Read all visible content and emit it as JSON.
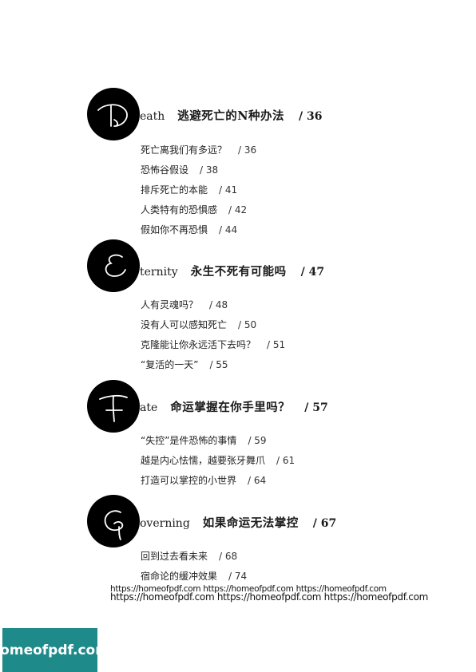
{
  "sections": [
    {
      "initial": "D",
      "english_rest": "eath",
      "chinese_title": "逃避死亡的N种办法",
      "page": "/ 36",
      "items": [
        {
          "title": "死亡离我们有多远？",
          "page": "/ 36"
        },
        {
          "title": "恐怖谷假设",
          "page": "/ 38"
        },
        {
          "title": "排斥死亡的本能",
          "page": "/ 41"
        },
        {
          "title": "人类特有的恐惧感",
          "page": "/ 42"
        },
        {
          "title": "假如你不再恐惧",
          "page": "/ 44"
        }
      ]
    },
    {
      "initial": "E",
      "english_rest": "ternity",
      "chinese_title": "永生不死有可能吗",
      "page": "/ 47",
      "items": [
        {
          "title": "人有灵魂吗？",
          "page": "/ 48"
        },
        {
          "title": "没有人可以感知死亡",
          "page": "/ 50"
        },
        {
          "title": "克隆能让你永远活下去吗？",
          "page": "/ 51"
        },
        {
          "title": "“复活的一天”",
          "page": "/ 55"
        }
      ]
    },
    {
      "initial": "F",
      "english_rest": "ate",
      "chinese_title": "命运掌握在你手里吗？",
      "page": "/ 57",
      "items": [
        {
          "title": "“失控”是件恐怖的事情",
          "page": "/ 59"
        },
        {
          "title": "越是内心怯懦，越要张牙舞爪",
          "page": "/ 61"
        },
        {
          "title": "打造可以掌控的小世界",
          "page": "/ 64"
        }
      ]
    },
    {
      "initial": "G",
      "english_rest": "overning",
      "chinese_title": "如果命运无法掌控",
      "page": "/ 67",
      "items": [
        {
          "title": "回到过去看未来",
          "page": "/ 68"
        },
        {
          "title": "宿命论的缓冲效果",
          "page": "/ 74"
        }
      ]
    }
  ],
  "watermark": {
    "line1": "https://homeofpdf.com https://homeofpdf.com https://homeofpdf.com",
    "line2": "https://homeofpdf.com https://homeofpdf.com https://homeofpdf.com"
  },
  "logo": "homeofpdf.com"
}
